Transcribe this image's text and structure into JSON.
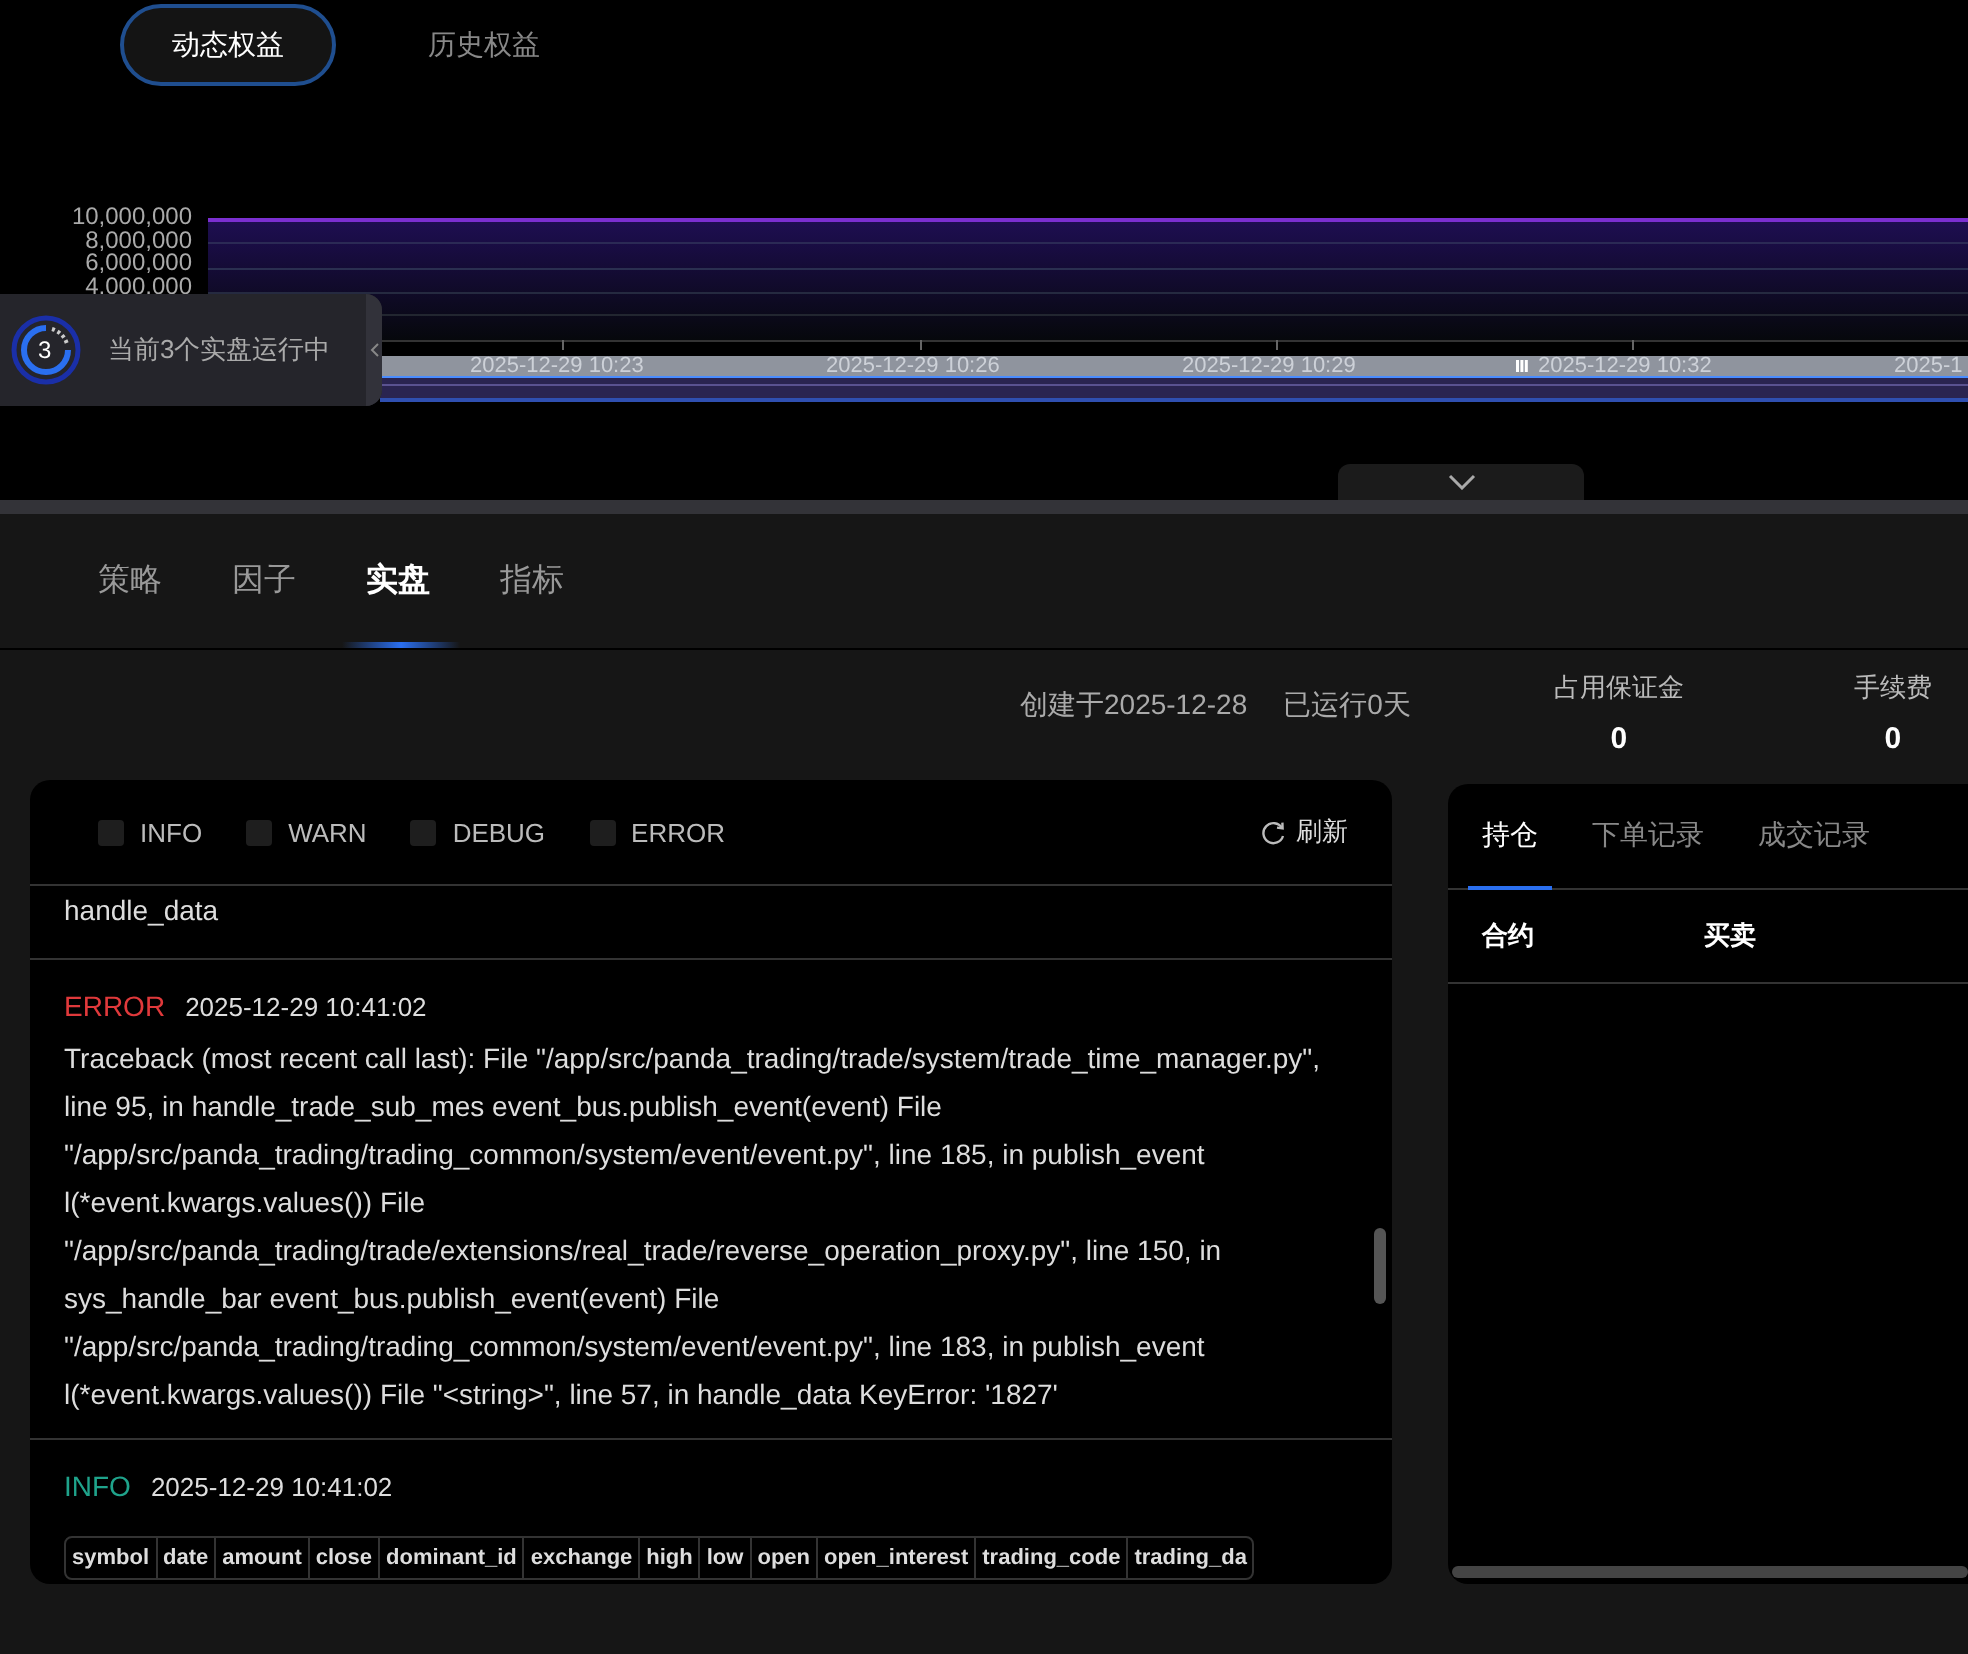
{
  "equity_tabs": [
    {
      "label": "动态权益",
      "selected": true
    },
    {
      "label": "历史权益",
      "selected": false
    }
  ],
  "chart": {
    "y_labels": [
      "10,000,000",
      "8,000,000",
      "6,000,000",
      "4,000,000"
    ],
    "x_labels": [
      "2025-12-29 10:23",
      "2025-12-29 10:26",
      "2025-12-29 10:29",
      "2025-12-29 10:32",
      "2025-1"
    ],
    "zoom_slider": {
      "level": 1
    }
  },
  "running_badge": {
    "count": "3",
    "text": "当前3个实盘运行中"
  },
  "main_tabs": [
    {
      "label": "策略",
      "selected": false
    },
    {
      "label": "因子",
      "selected": false
    },
    {
      "label": "实盘",
      "selected": true
    },
    {
      "label": "指标",
      "selected": false
    }
  ],
  "summary": {
    "created": "创建于2025-12-28",
    "running": "已运行0天"
  },
  "stats": [
    {
      "label": "占用保证金",
      "value": "0"
    },
    {
      "label": "手续费",
      "value": "0"
    }
  ],
  "log_panel": {
    "filters": [
      {
        "label": "INFO",
        "checked": false
      },
      {
        "label": "WARN",
        "checked": false
      },
      {
        "label": "DEBUG",
        "checked": false
      },
      {
        "label": "ERROR",
        "checked": false
      }
    ],
    "refresh": "刷新",
    "entries": [
      {
        "kind": "tail",
        "text": "handle_data"
      },
      {
        "kind": "message",
        "level": "ERROR",
        "color": "#e0393b",
        "time": "2025-12-29 10:41:02",
        "message": "Traceback (most recent call last): File \"/app/src/panda_trading/trade/system/trade_time_manager.py\", line 95, in handle_trade_sub_mes event_bus.publish_event(event) File \"/app/src/panda_trading/trading_common/system/event/event.py\", line 185, in publish_event l(*event.kwargs.values()) File \"/app/src/panda_trading/trade/extensions/real_trade/reverse_operation_proxy.py\", line 150, in sys_handle_bar event_bus.publish_event(event) File \"/app/src/panda_trading/trading_common/system/event/event.py\", line 183, in publish_event l(*event.kwargs.values()) File \"<string>\", line 57, in handle_data KeyError: '1827'"
      },
      {
        "kind": "table",
        "level": "INFO",
        "color": "#1fa38b",
        "time": "2025-12-29 10:41:02",
        "columns": [
          "symbol",
          "date",
          "amount",
          "close",
          "dominant_id",
          "exchange",
          "high",
          "low",
          "open",
          "open_interest",
          "trading_code",
          "trading_da"
        ]
      }
    ]
  },
  "positions_panel": {
    "tabs": [
      {
        "label": "持仓",
        "selected": true
      },
      {
        "label": "下单记录",
        "selected": false
      },
      {
        "label": "成交记录",
        "selected": false
      }
    ],
    "columns": [
      "合约",
      "买卖"
    ]
  }
}
